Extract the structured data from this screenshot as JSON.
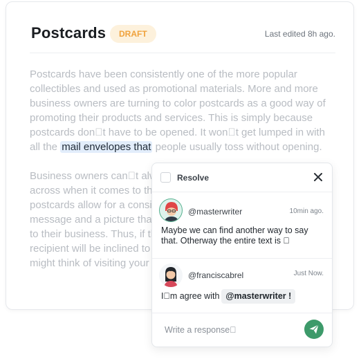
{
  "document": {
    "title": "Postcards",
    "status_badge": "DRAFT",
    "last_edited": "Last edited 8h ago."
  },
  "body": {
    "p1_before": "Postcards have been consistently one of the more popular collectibles and used as promotional materials. More and more business owners are turning to color postcards as a good way of promoting their products and services. This is simply because postcards don\u0000t have to be opened. It won\u0000t get lumped in with all the ",
    "p1_highlight": "mail envelopes that",
    "p1_after": " people usually toss without opening.",
    "p2": "Business owners can\u0000t always be sure their message gets across when it comes to their promotional materials. Color postcards allow for a considerable amount of room for the message and a picture that will entice them to bring greater sales to their business. Thus, if the postcard reveals a large picture, the recipient will be inclined to flip it over to see who sent it. They might think of visiting your store."
  },
  "comments_popover": {
    "resolve_label": "Resolve",
    "comments": [
      {
        "handle": "@masterwriter",
        "time": "10min ago.",
        "text": "Maybe we can find another way to say that. Otherway the entire text is \u0000"
      },
      {
        "handle": "@franciscabrel",
        "time": "Just Now.",
        "text_before": "I\u0000m agree with",
        "mention": "@masterwriter !"
      }
    ],
    "reply_placeholder": "Write a response\u0000"
  },
  "colors": {
    "accent_green": "#3d9a6a",
    "badge_bg": "#fdf1dc",
    "badge_text": "#f0a23c",
    "highlight_bg": "#e2edfb"
  },
  "icons": [
    "close-icon",
    "send-icon",
    "checkbox-icon"
  ]
}
